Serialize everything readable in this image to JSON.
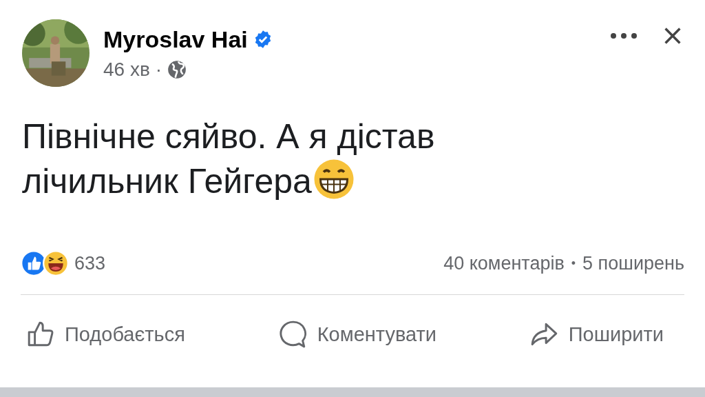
{
  "post": {
    "author": "Myroslav Hai",
    "verified": true,
    "time": "46 хв",
    "separator": "·",
    "text_lines": [
      "Північне сяйво. А я дістав",
      "лічильник Гейгера"
    ]
  },
  "stats": {
    "reactions": "633",
    "comments": "40 коментарів",
    "separator": "•",
    "shares": "5 поширень"
  },
  "actions": [
    {
      "kind": "like",
      "label": "Подобається"
    },
    {
      "kind": "comment",
      "label": "Коментувати"
    },
    {
      "kind": "share",
      "label": "Поширити"
    }
  ]
}
